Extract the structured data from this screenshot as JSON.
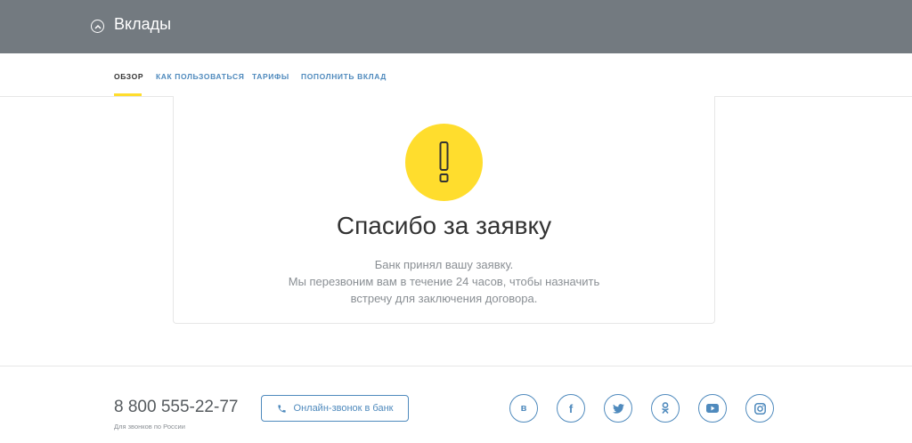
{
  "header": {
    "title": "Вклады"
  },
  "tabs": [
    {
      "label": "Обзор",
      "active": true
    },
    {
      "label": "Как пользоваться",
      "active": false
    },
    {
      "label": "Тарифы",
      "active": false
    },
    {
      "label": "Пополнить вклад",
      "active": false
    }
  ],
  "card": {
    "icon": "exclamation-icon",
    "title": "Спасибо за заявку",
    "lines": [
      "Банк принял вашу заявку.",
      "Мы перезвоним вам в течение 24 часов, чтобы назначить",
      "встречу для заключения договора."
    ]
  },
  "footer": {
    "phone": "8 800 555-22-77",
    "phone_note": "Для звонков по России",
    "call_button": "Онлайн-звонок в банк",
    "social": [
      {
        "name": "vk-icon",
        "glyph": "в"
      },
      {
        "name": "facebook-icon",
        "glyph": "f"
      },
      {
        "name": "twitter-icon",
        "glyph": ""
      },
      {
        "name": "odnoklassniki-icon",
        "glyph": ""
      },
      {
        "name": "youtube-icon",
        "glyph": ""
      },
      {
        "name": "instagram-icon",
        "glyph": ""
      }
    ]
  },
  "colors": {
    "header_bg": "#737a80",
    "accent_yellow": "#ffdd2d",
    "link_blue": "#4f8abd",
    "text_dark": "#333333",
    "text_muted": "#8a8f94"
  }
}
